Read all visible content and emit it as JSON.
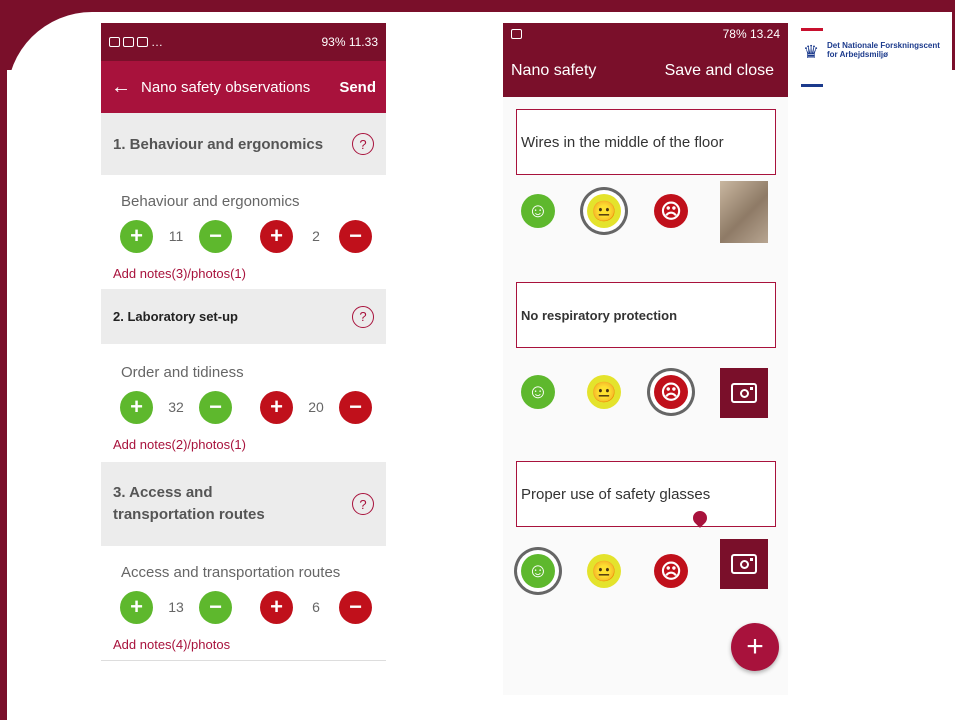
{
  "phone1": {
    "status": {
      "left": "…",
      "right": "93% 11.33"
    },
    "header": {
      "back": "←",
      "title": "Nano safety observations",
      "send": "Send"
    },
    "sections": [
      {
        "title": "1. Behaviour and ergonomics",
        "category": "Behaviour and  ergonomics",
        "pos_count": "11",
        "neg_count": "2",
        "notes": "Add notes(3)/photos(1)"
      },
      {
        "title": "2.  Laboratory  set-up",
        "category": "Order and tidiness",
        "pos_count": "32",
        "neg_count": "20",
        "notes": "Add notes(2)/photos(1)"
      },
      {
        "title": "3. Access and transportation routes",
        "category": "Access and transportation routes",
        "pos_count": "13",
        "neg_count": "6",
        "notes": "Add notes(4)/photos"
      }
    ],
    "help_symbol": "?",
    "plus_symbol": "+",
    "minus_symbol": "−"
  },
  "phone2": {
    "status": {
      "right": "78% 13.24"
    },
    "header": {
      "title": "Nano safety",
      "action": "Save and close"
    },
    "observations": [
      {
        "text": "Wires in the middle of the floor",
        "selected": "neutral"
      },
      {
        "text": "No respiratory  protection",
        "selected": "negative"
      },
      {
        "text": "Proper use of safety glasses",
        "selected": "positive"
      }
    ],
    "face_happy": "☺",
    "face_neutral": "😐",
    "face_sad": "☹",
    "fab": "+"
  },
  "logo": {
    "line1": "Det Nationale Forskningscent",
    "line2": "for Arbejdsmiljø"
  },
  "colors": {
    "frame": "#7a0f2a",
    "header": "#a8123c",
    "positive": "#5eb82d",
    "neutral": "#e4e32c",
    "negative": "#c0101b"
  }
}
